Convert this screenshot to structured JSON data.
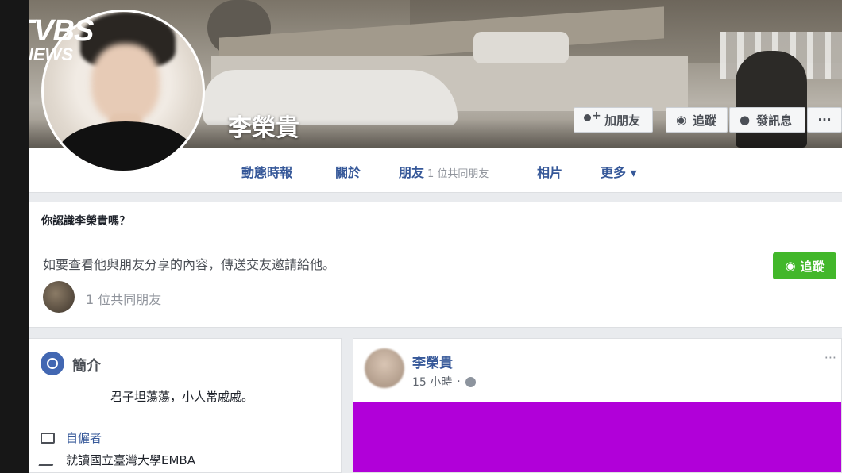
{
  "watermark": {
    "line1": "TVBS",
    "line2": "NEWS"
  },
  "profile": {
    "name": "李榮貴"
  },
  "cover_buttons": {
    "add_friend": "加朋友",
    "follow": "追蹤",
    "message": "發訊息",
    "more": "···"
  },
  "nav": {
    "timeline": "動態時報",
    "about": "關於",
    "friends": "朋友",
    "friends_mutual": "1 位共同朋友",
    "photos": "相片",
    "more": "更多 ▾"
  },
  "know_card": {
    "title": "你認識李榮貴嗎？",
    "text": "如要查看他與朋友分享的內容，傳送交友邀請給他。",
    "mutual": "1 位共同朋友",
    "follow_button": "追蹤"
  },
  "intro": {
    "title": "簡介",
    "motto": "君子坦蕩蕩，小人常戚戚。",
    "work": "自僱者",
    "education": "就讀國立臺灣大學EMBA"
  },
  "post": {
    "author": "李榮貴",
    "time": "15 小時",
    "menu": "···",
    "media_color": "#b100d9"
  },
  "icons": [
    "person-add-icon",
    "rss-icon",
    "messenger-icon",
    "globe-icon",
    "briefcase-icon",
    "graduation-cap-icon"
  ],
  "colors": {
    "facebook_blue": "#365899",
    "follow_green": "#42b72a"
  }
}
